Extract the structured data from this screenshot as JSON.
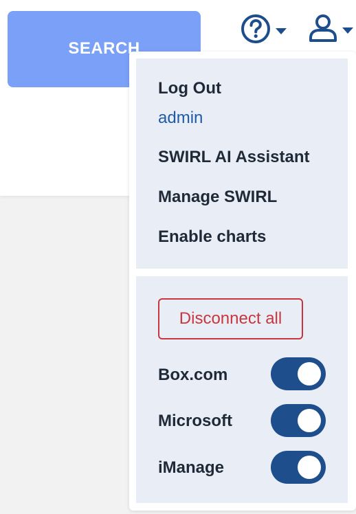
{
  "search": {
    "label": "SEARCH"
  },
  "header": {
    "help_icon": "help-circle-icon",
    "user_icon": "user-icon",
    "caret_icon": "caret-down-icon"
  },
  "user_menu": {
    "items": [
      {
        "label": "Log Out"
      },
      {
        "label": "SWIRL AI Assistant"
      },
      {
        "label": "Manage SWIRL"
      },
      {
        "label": "Enable charts"
      }
    ],
    "username": "admin"
  },
  "connections": {
    "disconnect_label": "Disconnect all",
    "items": [
      {
        "name": "Box.com",
        "enabled": true
      },
      {
        "name": "Microsoft",
        "enabled": true
      },
      {
        "name": "iManage",
        "enabled": true
      }
    ]
  },
  "colors": {
    "search_button": "#7aa0f8",
    "toggle_on": "#1e4e8c",
    "username": "#1e5aa8",
    "disconnect": "#c9363e",
    "menu_background": "#e9eef6"
  }
}
